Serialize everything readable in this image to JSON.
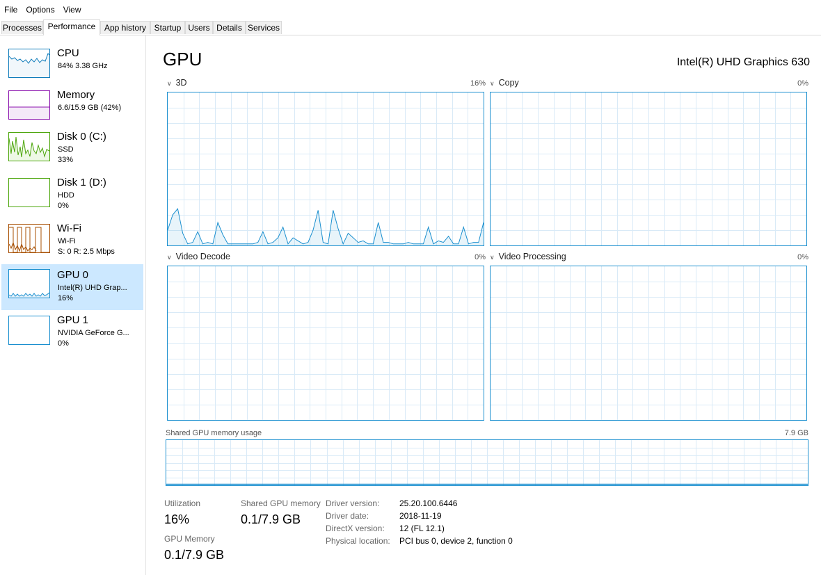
{
  "menu": [
    "File",
    "Options",
    "View"
  ],
  "tabs": [
    "Processes",
    "Performance",
    "App history",
    "Startup",
    "Users",
    "Details",
    "Services"
  ],
  "sidebar": [
    {
      "title": "CPU",
      "line1": "84% 3.38 GHz",
      "line2": "",
      "line3": "",
      "color": "#117dbb"
    },
    {
      "title": "Memory",
      "line1": "6.6/15.9 GB (42%)",
      "line2": "",
      "line3": "",
      "color": "#8b12ae"
    },
    {
      "title": "Disk 0 (C:)",
      "line1": "SSD",
      "line2": "33%",
      "line3": "",
      "color": "#4da60c"
    },
    {
      "title": "Disk 1 (D:)",
      "line1": "HDD",
      "line2": "0%",
      "line3": "",
      "color": "#4da60c"
    },
    {
      "title": "Wi-Fi",
      "line1": "Wi-Fi",
      "line2": "S: 0 R: 2.5 Mbps",
      "line3": "",
      "color": "#a74f01"
    },
    {
      "title": "GPU 0",
      "line1": "Intel(R) UHD Grap...",
      "line2": "16%",
      "line3": "",
      "color": "#1a8fcf"
    },
    {
      "title": "GPU 1",
      "line1": "NVIDIA GeForce G...",
      "line2": "0%",
      "line3": "",
      "color": "#1a8fcf"
    }
  ],
  "main": {
    "title": "GPU",
    "device": "Intel(R) UHD Graphics 630"
  },
  "graphs": [
    {
      "label": "3D",
      "pct": "16%"
    },
    {
      "label": "Copy",
      "pct": "0%"
    },
    {
      "label": "Video Decode",
      "pct": "0%"
    },
    {
      "label": "Video Processing",
      "pct": "0%"
    }
  ],
  "shared_memory": {
    "label": "Shared GPU memory usage",
    "max": "7.9 GB"
  },
  "stats": {
    "utilization_label": "Utilization",
    "utilization_value": "16%",
    "shared_label": "Shared GPU memory",
    "shared_value": "0.1/7.9 GB",
    "gpu_memory_label": "GPU Memory",
    "gpu_memory_value": "0.1/7.9 GB"
  },
  "info": [
    {
      "label": "Driver version:",
      "value": "25.20.100.6446"
    },
    {
      "label": "Driver date:",
      "value": "2018-11-19"
    },
    {
      "label": "DirectX version:",
      "value": "12 (FL 12.1)"
    },
    {
      "label": "Physical location:",
      "value": "PCI bus 0, device 2, function 0"
    }
  ],
  "chart_data": {
    "type": "area",
    "title": "3D",
    "ylim": [
      0,
      100
    ],
    "values": [
      10,
      20,
      24,
      8,
      1,
      2,
      9,
      1,
      2,
      1,
      15,
      7,
      1,
      1,
      1,
      1,
      1,
      1,
      2,
      9,
      1,
      2,
      5,
      12,
      1,
      5,
      3,
      1,
      2,
      10,
      23,
      2,
      1,
      23,
      11,
      1,
      8,
      5,
      2,
      3,
      1,
      1,
      15,
      2,
      2,
      1,
      1,
      1,
      2,
      1,
      1,
      1,
      12,
      1,
      3,
      2,
      6,
      1,
      1,
      12,
      1,
      2,
      2,
      15
    ]
  }
}
